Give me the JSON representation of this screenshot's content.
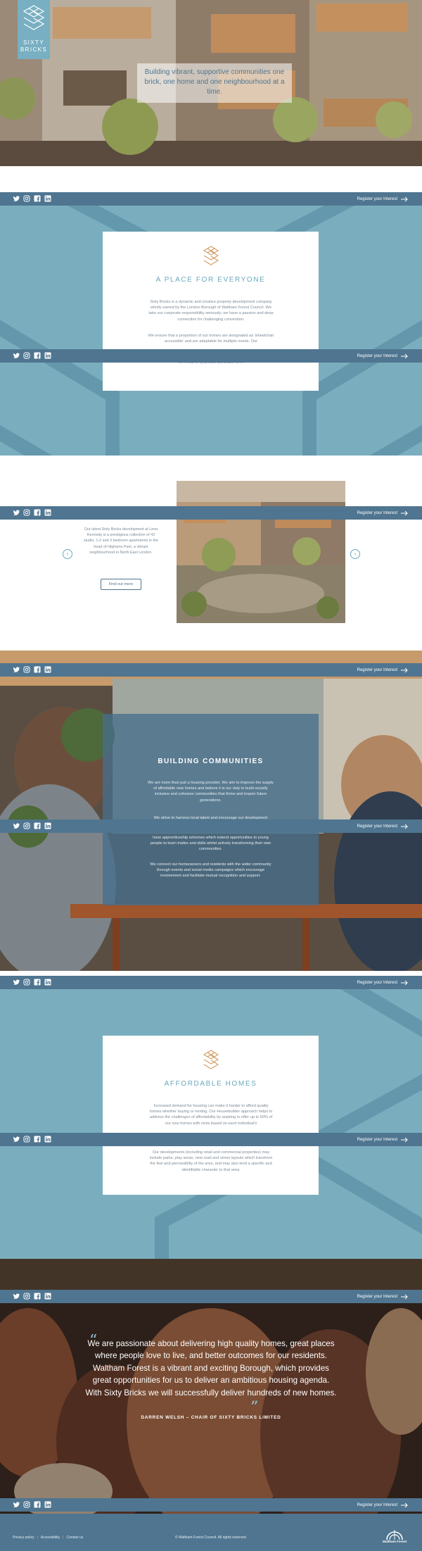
{
  "brand": {
    "line1": "SIXTY",
    "line2": "BRICKS"
  },
  "hero": {
    "tagline": "Building vibrant, supportive communities one brick, one home and one neighbourhood at a time."
  },
  "nav": {
    "social": [
      "twitter-icon",
      "instagram-icon",
      "facebook-icon",
      "linkedin-icon"
    ],
    "register_label": "Register your Interest"
  },
  "place": {
    "title": "A PLACE FOR EVERYONE",
    "paragraphs": [
      "Sixty Bricks is a dynamic and creative property development company wholly owned by the London Borough of Waltham Forest Council. We take our corporate responsibility seriously; we have a passion and deep connection for challenging convention.",
      "We ensure that a proportion of our homes are designated as 'wheelchair accessible' and are adaptable for multiple needs. Our",
      "it's rental or by private purchase form."
    ]
  },
  "development": {
    "text": "Our latest Sixty Bricks development at Lena Kennedy is a prestigious collection of 43 studio, 1-2 and 3 bedroom apartments in the heart of Highams Park, a vibrant neighbourhood in North East London.",
    "button": "Find out more",
    "prev": "‹",
    "next": "›"
  },
  "communities": {
    "title": "BUILDING COMMUNITIES",
    "paragraphs": [
      "We are more than just a housing provider. We aim to improve the supply of affordable new homes and believe it is our duty to build socially inclusive and cohesive communities that thrive and inspire future generations.",
      "We strive to harness local talent and encourage our development",
      "have apprenticeship schemes which extend opportunities to young people to learn trades and skills whilst actively transforming their own communities.",
      "We connect our homeowners and residents with the wider community through events and social media campaigns which encourage involvement and facilitate mutual recognition and support."
    ]
  },
  "affordable": {
    "title": "AFFORDABLE HOMES",
    "paragraphs": [
      "Increased demand for housing can make it harder to afford quality homes whether buying or renting. Our Housebuilder approach helps to address the challenges of affordability by aspiring to offer up to 50% of our new homes with rents based on each individual's",
      "Our developments (including retail and commercial properties) may include parks, play areas, new road and street layouts which transform the feel and permeability of the area, and may also lend a specific and identifiable character to that area."
    ]
  },
  "quote": {
    "text": "We are passionate about delivering high quality homes, great places where people love to live, and better outcomes for our residents. Waltham Forest is a vibrant and exciting Borough, which provides great opportunities for us to deliver an ambitious housing agenda. With Sixty Bricks we will successfully deliver hundreds of new homes.",
    "open": "“",
    "close": "”",
    "attribution": "DARREN WELSH – CHAIR OF SIXTY BRICKS LIMITED"
  },
  "footer": {
    "links": [
      "Privacy policy",
      "Accessibility",
      "Contact us"
    ],
    "copyright": "© Waltham Forest Council. All rights reserved.",
    "council_line1": "Waltham Forest"
  },
  "colors": {
    "accent": "#7aaebe",
    "nav": "#4f7590",
    "title": "#6aa9ba"
  }
}
